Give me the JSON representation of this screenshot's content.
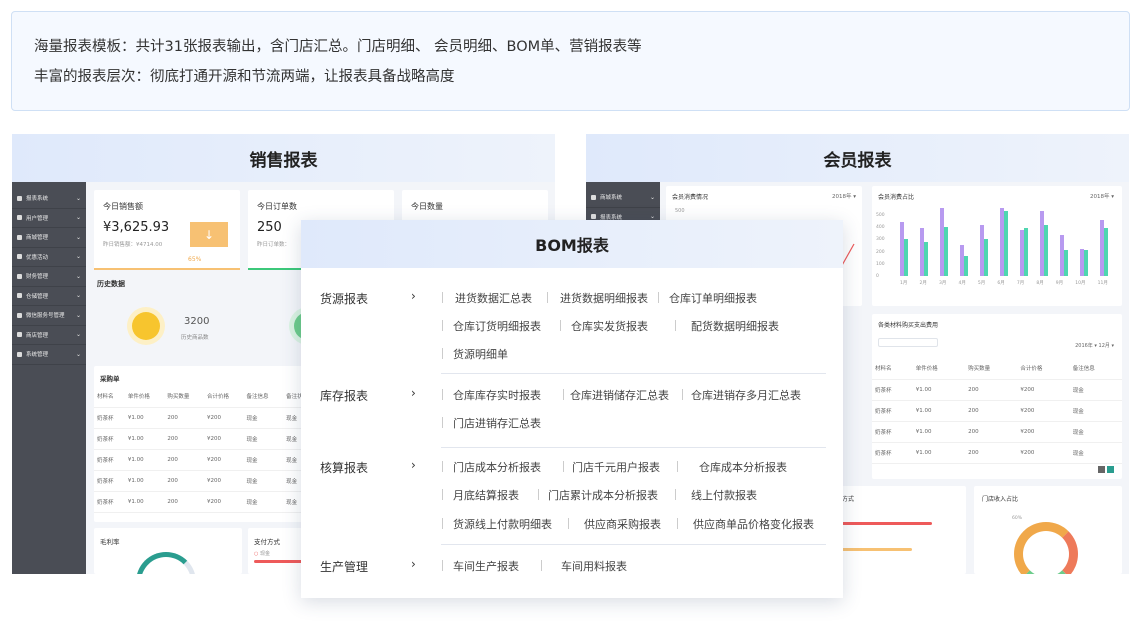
{
  "intro": {
    "line1": "海量报表模板：共计31张报表输出，含门店汇总。门店明细、 会员明细、BOM单、营销报表等",
    "line2": "丰富的报表层次：彻底打通开源和节流两端，让报表具备战略高度"
  },
  "sales": {
    "title": "销售报表",
    "sidebar": [
      "报表系统",
      "用户管理",
      "商城管理",
      "优惠活动",
      "财务管理",
      "仓储管理",
      "微信服务号管理",
      "商店管理",
      "系统管理"
    ],
    "card1": {
      "label": "今日销售额",
      "value": "¥3,625.93",
      "sub": "昨日销售额：¥4714.00",
      "pct": "65%"
    },
    "card2": {
      "label": "今日订单数",
      "value": "250",
      "sub": "昨日订单数："
    },
    "card3": {
      "label": "今日数量"
    },
    "history_title": "历史数据",
    "history_value": "3200",
    "history_label": "历史商品数",
    "purchase_title": "采购单",
    "headers": [
      "材料名",
      "单件价格",
      "购买数量",
      "合计价格",
      "备注信息",
      "备注状"
    ],
    "rows": [
      [
        "奶茶杯",
        "¥1.00",
        "200",
        "¥200",
        "现金",
        "现金"
      ],
      [
        "奶茶杯",
        "¥1.00",
        "200",
        "¥200",
        "现金",
        "现金"
      ],
      [
        "奶茶杯",
        "¥1.00",
        "200",
        "¥200",
        "现金",
        "现金"
      ],
      [
        "奶茶杯",
        "¥1.00",
        "200",
        "¥200",
        "现金",
        "现金"
      ],
      [
        "奶茶杯",
        "¥1.00",
        "200",
        "¥200",
        "现金",
        "现金"
      ]
    ],
    "gross_title": "毛利率",
    "pay_title": "支付方式",
    "pay_item": "现金"
  },
  "member": {
    "title": "会员报表",
    "sidebar": [
      "商城系统",
      "报表系统"
    ],
    "chart1_title": "会员消费情况",
    "chart1_year": "2018年",
    "chart1_ytick": "500",
    "chart2_title": "会员消费占比",
    "chart2_year": "2018年",
    "chart2_yticks": [
      "500",
      "400",
      "300",
      "200",
      "100",
      "0"
    ],
    "chart2_months": [
      "1月",
      "2月",
      "3月",
      "4月",
      "5月",
      "6月",
      "7月",
      "8月",
      "9月",
      "10月",
      "11月"
    ],
    "table_title": "各类材料购买支出费用",
    "filter_year": "2016年",
    "filter_month": "12月",
    "headers": [
      "材料名",
      "单件价格",
      "购买数量",
      "合计价格",
      "备注信息"
    ],
    "rows": [
      [
        "奶茶杯",
        "¥1.00",
        "200",
        "¥200",
        "现金"
      ],
      [
        "奶茶杯",
        "¥1.00",
        "200",
        "¥200",
        "现金"
      ],
      [
        "奶茶杯",
        "¥1.00",
        "200",
        "¥200",
        "现金"
      ],
      [
        "奶茶杯",
        "¥1.00",
        "200",
        "¥200",
        "现金"
      ]
    ],
    "pay_title": "方式",
    "income_title": "门店收入占比",
    "income_pct": "60%"
  },
  "bom": {
    "title": "BOM报表",
    "groups": [
      {
        "name": "货源报表",
        "items": [
          "进货数据汇总表",
          "进货数据明细报表",
          "仓库订单明细报表",
          "仓库订货明细报表",
          "仓库实发货报表",
          "配货数据明细报表",
          "货源明细单"
        ]
      },
      {
        "name": "库存报表",
        "items": [
          "仓库库存实时报表",
          "仓库进销储存汇总表",
          "仓库进销存多月汇总表",
          "门店进销存汇总表"
        ]
      },
      {
        "name": "核算报表",
        "items": [
          "门店成本分析报表",
          "门店千元用户报表",
          "仓库成本分析报表",
          "月底结算报表",
          "门店累计成本分析报表",
          "线上付款报表",
          "货源线上付款明细表",
          "供应商采购报表",
          "供应商单品价格变化报表"
        ]
      },
      {
        "name": "生产管理",
        "items": [
          "车间生产报表",
          "车间用料报表"
        ]
      }
    ],
    "arrow": "›"
  },
  "colors": {
    "accent": "#4e8ef7",
    "bar_purple": "#b89af0",
    "bar_green": "#4fd6b0",
    "orange": "#f7c173",
    "line_red": "#ee5a5a"
  }
}
